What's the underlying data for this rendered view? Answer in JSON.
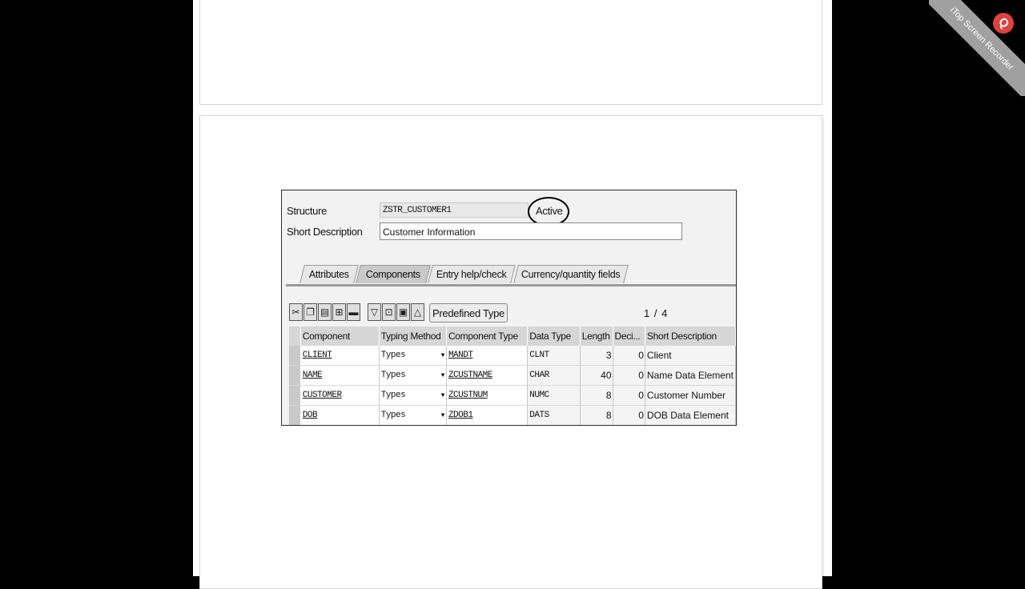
{
  "structure": {
    "label": "Structure",
    "value": "ZSTR_CUSTOMER1",
    "status": "Active"
  },
  "short_description": {
    "label": "Short Description",
    "value": "Customer Information"
  },
  "tabs": [
    {
      "label": "Attributes"
    },
    {
      "label": "Components"
    },
    {
      "label": "Entry help/check"
    },
    {
      "label": "Currency/quantity fields"
    }
  ],
  "toolbar": {
    "icons": [
      "cut-icon",
      "copy-icon",
      "paste-icon",
      "insert-row-icon",
      "delete-row-icon",
      "sort-icon",
      "insert-icon",
      "delete-icon",
      "filter-icon"
    ],
    "predefined_type_label": "Predefined Type",
    "pager": "1 / 4"
  },
  "table": {
    "columns": [
      "Component",
      "Typing Method",
      "Component Type",
      "Data Type",
      "Length",
      "Deci...",
      "Short Description"
    ],
    "rows": [
      {
        "component": "CLIENT",
        "typing": "Types",
        "ctype": "MANDT",
        "dtype": "CLNT",
        "length": "3",
        "deci": "0",
        "desc": "Client"
      },
      {
        "component": "NAME",
        "typing": "Types",
        "ctype": "ZCUSTNAME",
        "dtype": "CHAR",
        "length": "40",
        "deci": "0",
        "desc": "Name Data Element"
      },
      {
        "component": "CUSTOMER",
        "typing": "Types",
        "ctype": "ZCUSTNUM",
        "dtype": "NUMC",
        "length": "8",
        "deci": "0",
        "desc": "Customer Number"
      },
      {
        "component": "DOB",
        "typing": "Types",
        "ctype": "ZDOB1",
        "dtype": "DATS",
        "length": "8",
        "deci": "0",
        "desc": "DOB Data Element"
      }
    ]
  },
  "watermark": {
    "text": "iTop Screen Recorder"
  }
}
